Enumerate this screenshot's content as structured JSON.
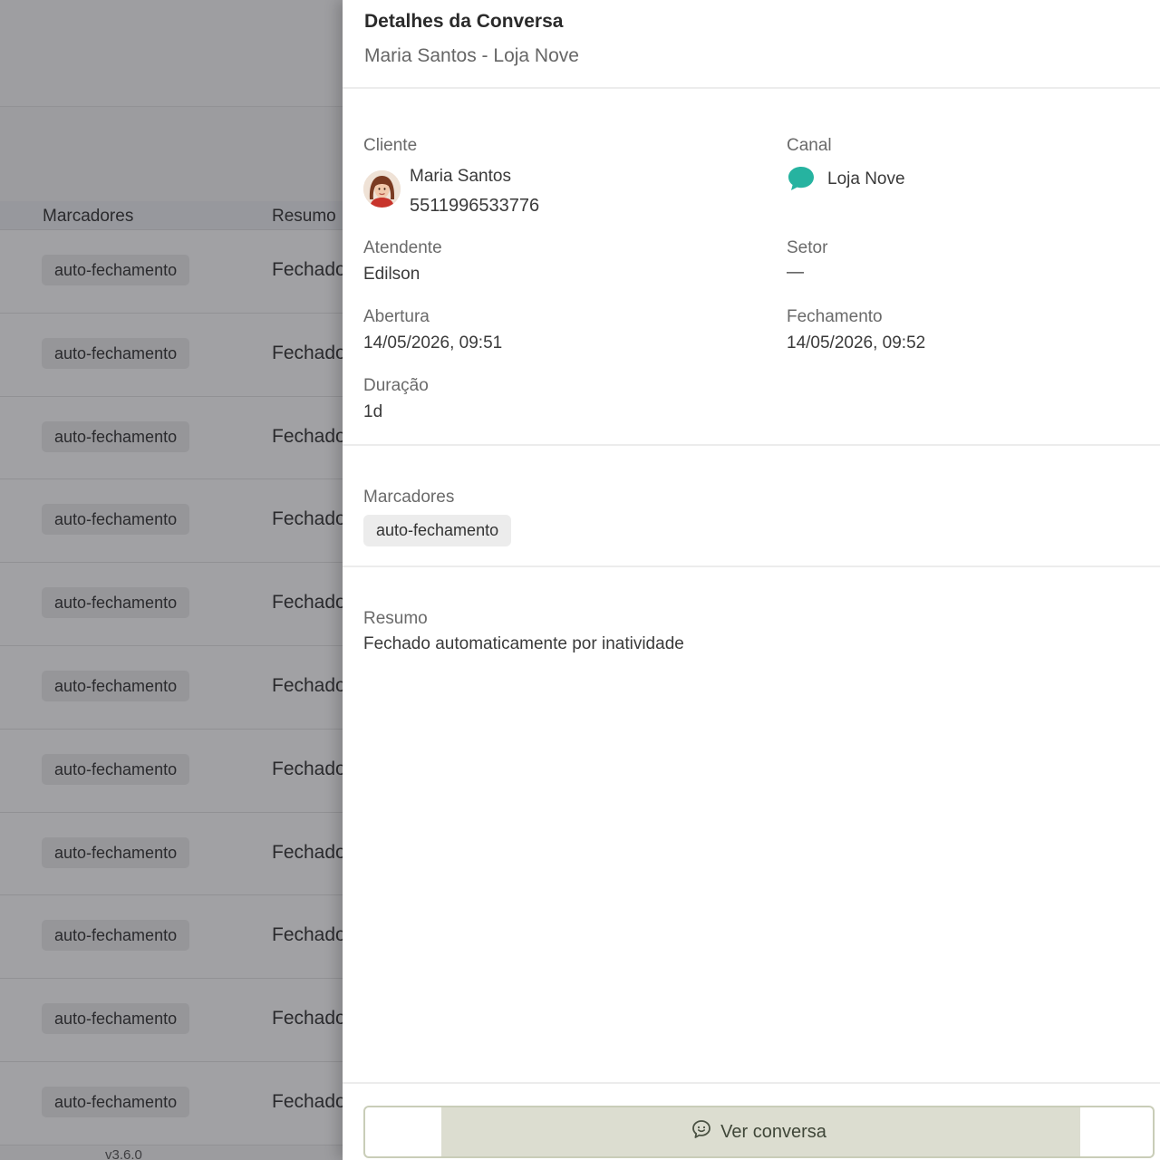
{
  "background": {
    "columns": [
      "Marcadores",
      "Resumo"
    ],
    "rows": [
      {
        "tag": "auto-fechamento",
        "summary": "Fechado"
      },
      {
        "tag": "auto-fechamento",
        "summary": "Fechado"
      },
      {
        "tag": "auto-fechamento",
        "summary": "Fechado"
      },
      {
        "tag": "auto-fechamento",
        "summary": "Fechado"
      },
      {
        "tag": "auto-fechamento",
        "summary": "Fechado"
      },
      {
        "tag": "auto-fechamento",
        "summary": "Fechado"
      },
      {
        "tag": "auto-fechamento",
        "summary": "Fechado"
      },
      {
        "tag": "auto-fechamento",
        "summary": "Fechado"
      },
      {
        "tag": "auto-fechamento",
        "summary": "Fechado"
      },
      {
        "tag": "auto-fechamento",
        "summary": "Fechado"
      },
      {
        "tag": "auto-fechamento",
        "summary": "Fechado"
      }
    ],
    "version": "v3.6.0"
  },
  "drawer": {
    "title": "Detalhes da Conversa",
    "subtitle": "Maria Santos - Loja Nove",
    "client": {
      "label": "Cliente",
      "name": "Maria Santos",
      "phone": "5511996533776"
    },
    "channel": {
      "label": "Canal",
      "name": "Loja Nove",
      "icon": "chat-bubble-icon",
      "color": "#26b3a0"
    },
    "agent": {
      "label": "Atendente",
      "value": "Edilson"
    },
    "sector": {
      "label": "Setor",
      "value": "—"
    },
    "opening": {
      "label": "Abertura",
      "value": "14/05/2026, 09:51"
    },
    "closing": {
      "label": "Fechamento",
      "value": "14/05/2026, 09:52"
    },
    "duration": {
      "label": "Duração",
      "value": "1d"
    },
    "tags": {
      "label": "Marcadores",
      "items": [
        "auto-fechamento"
      ]
    },
    "summary": {
      "label": "Resumo",
      "value": "Fechado automaticamente por inatividade"
    },
    "footer": {
      "button_label": "Ver conversa",
      "button_icon": "chat-smile-icon"
    }
  }
}
